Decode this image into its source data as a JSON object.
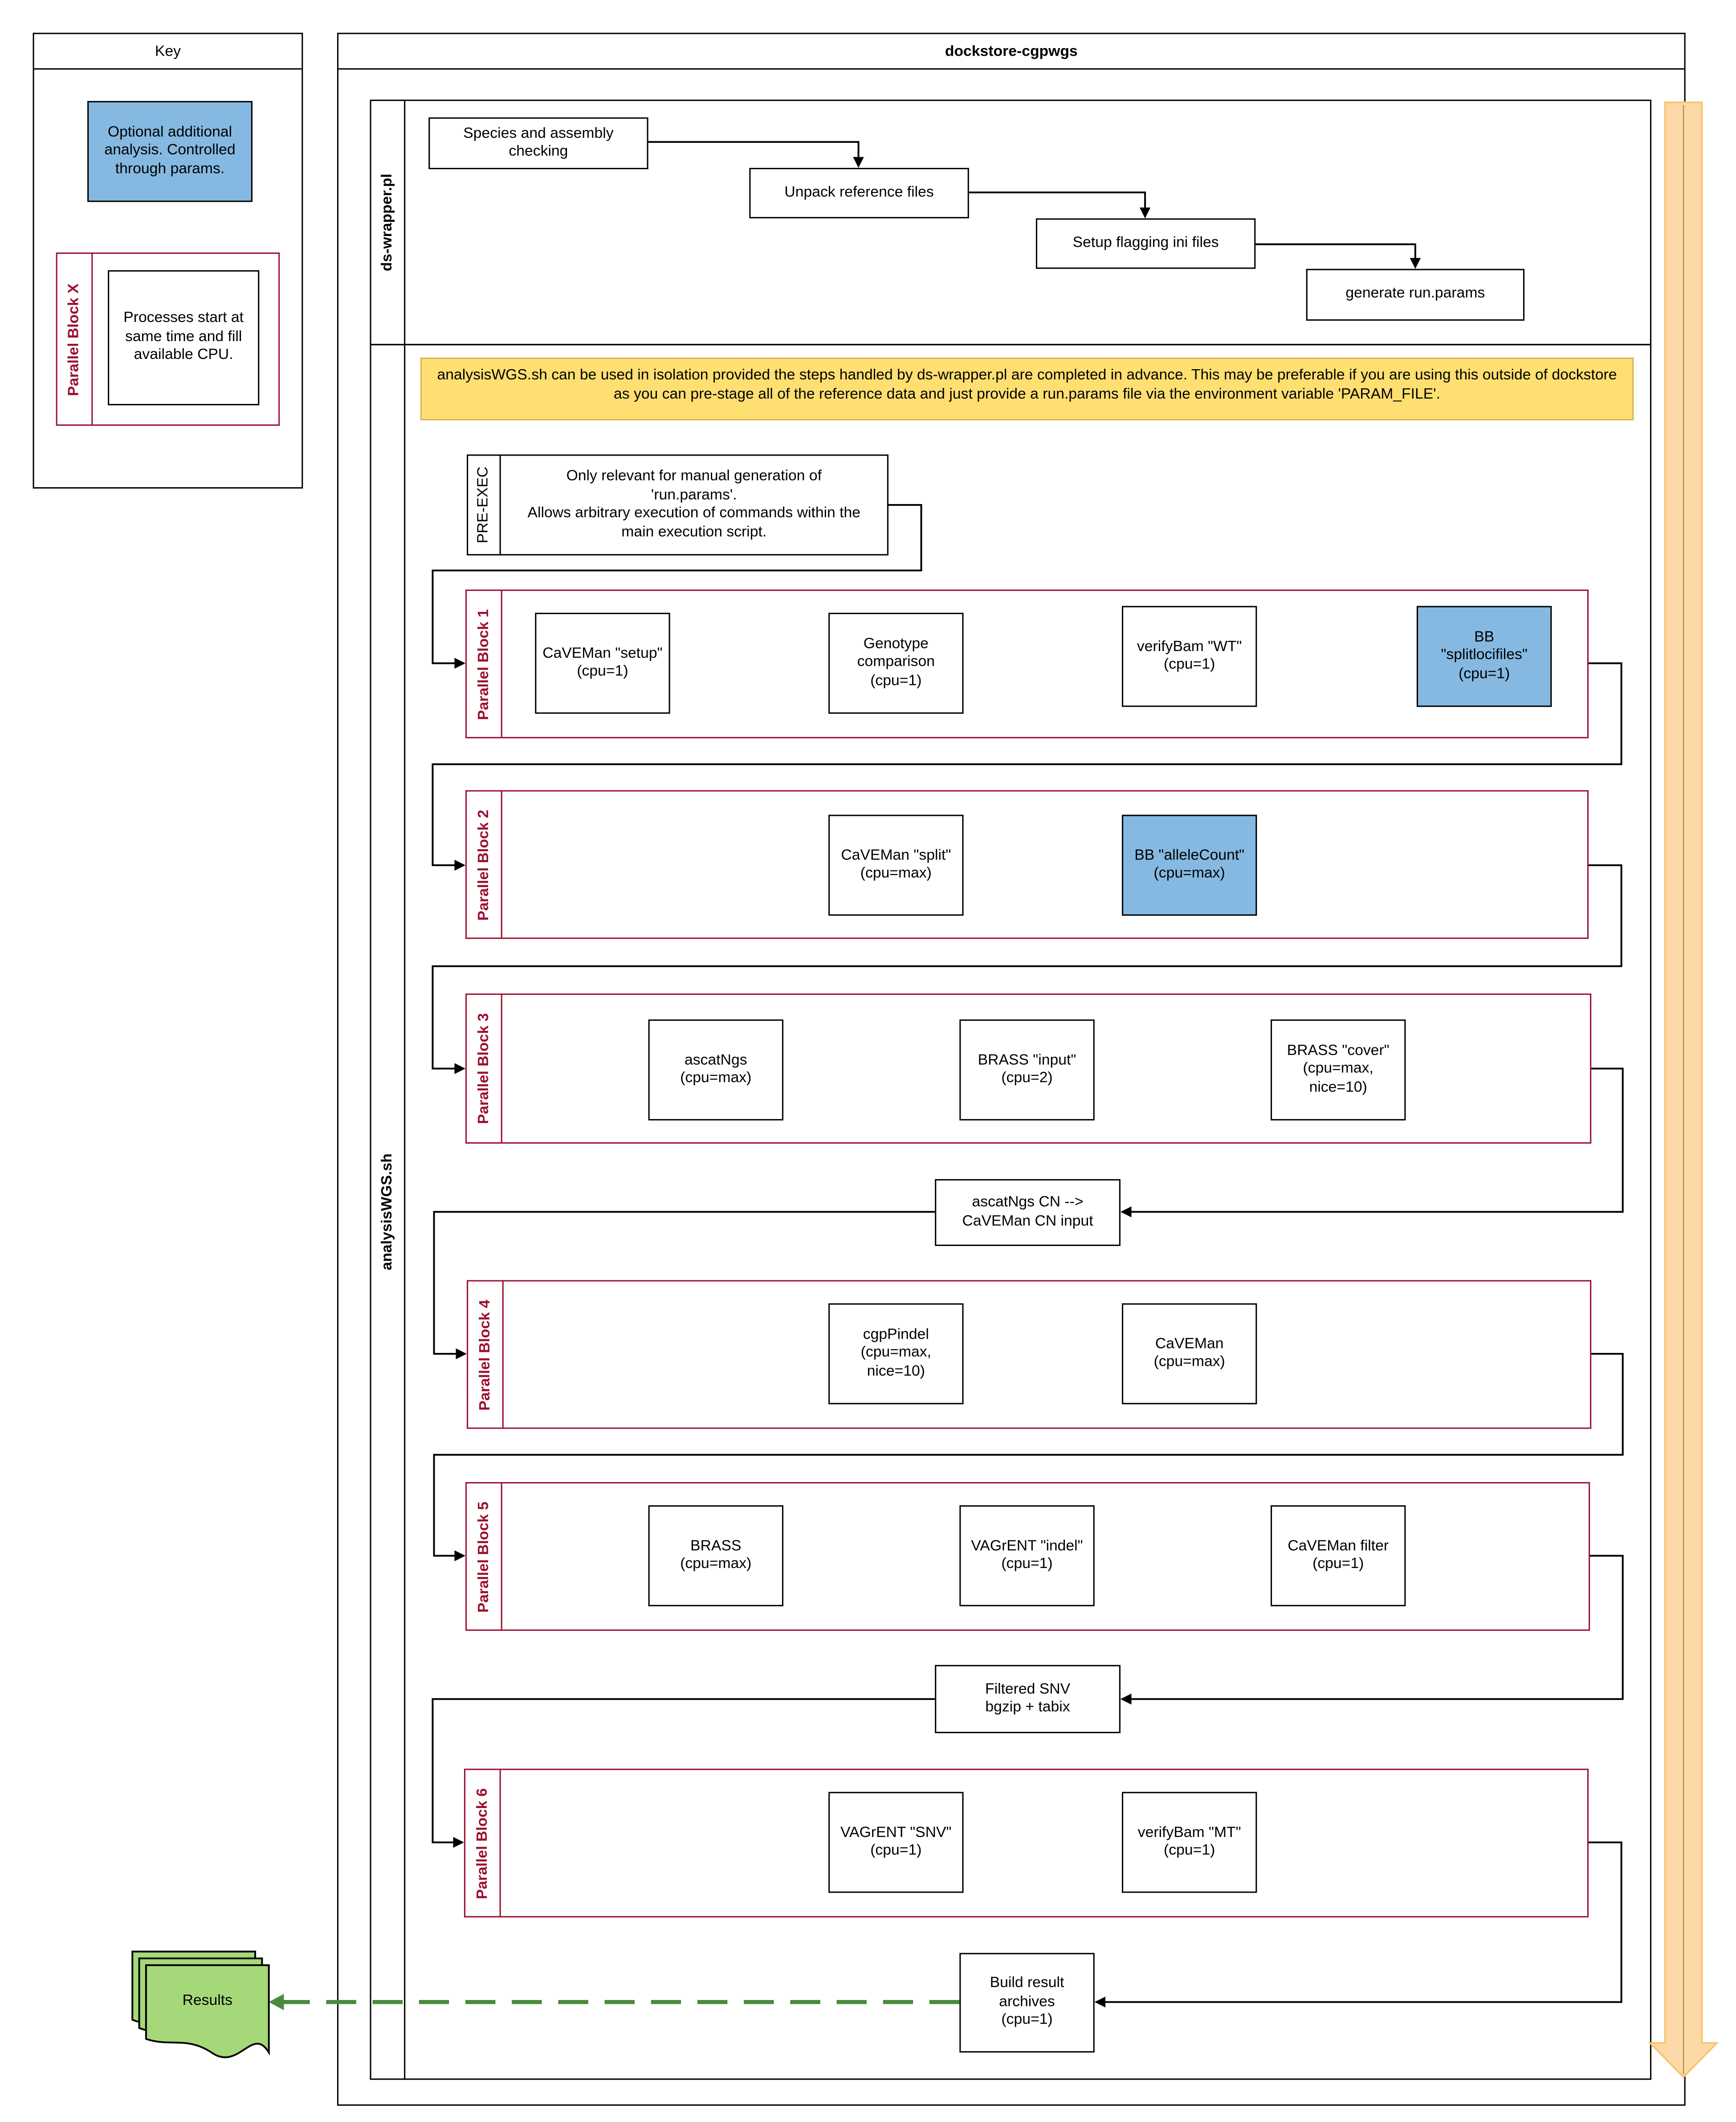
{
  "key": {
    "title": "Key",
    "optional_box": "Optional additional analysis.  Controlled through params.",
    "parallel_label": "Parallel Block X",
    "parallel_box": "Processes start at same time and fill available CPU."
  },
  "main": {
    "title": "dockstore-cgpwgs",
    "wrapper_lane": {
      "label": "ds-wrapper.pl",
      "steps": [
        "Species and assembly checking",
        "Unpack reference files",
        "Setup flagging ini files",
        "generate run.params"
      ]
    },
    "analysis_lane": {
      "label": "analysisWGS.sh",
      "note": "analysisWGS.sh can be used in isolation provided the steps handled by ds-wrapper.pl are completed in advance.  This may be preferable if you are using this outside of dockstore as you can pre-stage all of the reference data and just provide a run.params file via the environment variable 'PARAM_FILE'.",
      "pre_exec": {
        "label": "PRE-EXEC",
        "text": "Only relevant for manual generation of\n'run.params'.\nAllows arbitrary execution of commands within the\nmain execution script."
      },
      "blocks": [
        {
          "label": "Parallel Block 1",
          "tasks": [
            {
              "text": "CaVEMan \"setup\"\n(cpu=1)",
              "optional": false
            },
            {
              "text": "Genotype\ncomparison\n(cpu=1)",
              "optional": false
            },
            {
              "text": "verifyBam \"WT\"\n(cpu=1)",
              "optional": false
            },
            {
              "text": "BB\n\"splitlocifiles\"\n(cpu=1)",
              "optional": true
            }
          ]
        },
        {
          "label": "Parallel Block 2",
          "tasks": [
            {
              "text": "CaVEMan \"split\"\n(cpu=max)",
              "optional": false
            },
            {
              "text": "BB \"alleleCount\"\n(cpu=max)",
              "optional": true
            }
          ]
        },
        {
          "label": "Parallel Block 3",
          "tasks": [
            {
              "text": "ascatNgs\n(cpu=max)",
              "optional": false
            },
            {
              "text": "BRASS \"input\"\n(cpu=2)",
              "optional": false
            },
            {
              "text": "BRASS \"cover\"\n(cpu=max,\nnice=10)",
              "optional": false
            }
          ]
        },
        {
          "label": "Parallel Block 4",
          "tasks": [
            {
              "text": "cgpPindel\n(cpu=max,\nnice=10)",
              "optional": false
            },
            {
              "text": "CaVEMan\n(cpu=max)",
              "optional": false
            }
          ]
        },
        {
          "label": "Parallel Block 5",
          "tasks": [
            {
              "text": "BRASS\n(cpu=max)",
              "optional": false
            },
            {
              "text": "VAGrENT \"indel\"\n(cpu=1)",
              "optional": false
            },
            {
              "text": "CaVEMan filter\n(cpu=1)",
              "optional": false
            }
          ]
        },
        {
          "label": "Parallel Block 6",
          "tasks": [
            {
              "text": "VAGrENT \"SNV\"\n(cpu=1)",
              "optional": false
            },
            {
              "text": "verifyBam \"MT\"\n(cpu=1)",
              "optional": false
            }
          ]
        }
      ],
      "between_steps": {
        "after_block3": "ascatNgs CN -->\nCaVEMan CN input",
        "after_block5": "Filtered SNV\nbgzip + tabix",
        "final": "Build result\narchives\n(cpu=1)"
      }
    },
    "results": "Results"
  },
  "colors": {
    "optional_fill": "#85b9e1",
    "parallel_border": "#9b1030",
    "note_fill": "#ffdf71",
    "flow_arrow": "#fdd9a8",
    "results_fill": "#a5d878",
    "results_link": "#4b8a3c"
  }
}
